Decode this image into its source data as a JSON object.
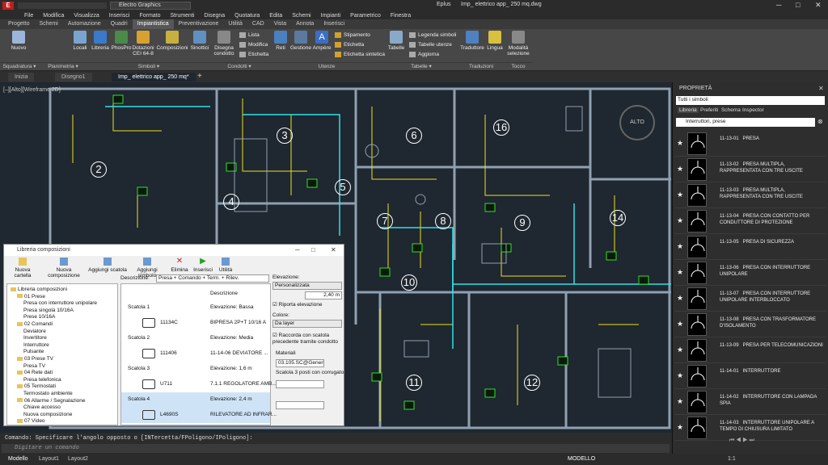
{
  "title_bar": {
    "app_name": "Electro Graphics",
    "product": "Eplus",
    "file": "Imp_ elettrico app_ 250 mq.dwg"
  },
  "menu": [
    "File",
    "Modifica",
    "Visualizza",
    "Inserisci",
    "Formato",
    "Strumenti",
    "Disegna",
    "Quotatura",
    "Edita",
    "Schemi",
    "Impianti",
    "Parametrico",
    "Finestra"
  ],
  "ribbon_tabs": [
    "Progetto",
    "Schemi",
    "Automazione",
    "Quadri",
    "Impiantistica",
    "Preventivazione",
    "Utilità",
    "CAD",
    "Vista",
    "Annota",
    "Inserisci"
  ],
  "ribbon_active": "Impiantistica",
  "ribbon": {
    "nuovo": "Nuovo",
    "locali": "Locali",
    "libreria": "Libreria",
    "phosphro": "PhosPro",
    "dotazioni": "Dotazioni CEI 64-8",
    "composizioni": "Composizioni",
    "sinottici": "Sinottici",
    "disegna": "Disegna condotto",
    "lista": "Lista",
    "modifica": "Modifica",
    "etichetta": "Etichetta",
    "reti": "Reti",
    "gestione": "Gestione",
    "ampere": "Ampère",
    "stipamento": "Stipamento",
    "etichetta2": "Etichetta",
    "etichetta_sintetica": "Etichetta sintetica",
    "tabelle": "Tabelle",
    "legenda": "Legenda simboli",
    "tabelle_utenze": "Tabelle utenze",
    "aggiorna": "Aggiorna",
    "traduttore": "Traduttore",
    "lingua": "Lingua",
    "modalita": "Modalità selezione",
    "groups": {
      "squadratura": "Squadratura ▾",
      "planimetria": "Planimetria ▾",
      "simboli": "Simboli ▾",
      "condotti": "Condotti ▾",
      "utenze": "Utenze",
      "tabelle": "Tabelle ▾",
      "traduzioni": "Traduzioni",
      "tocco": "Tocco"
    }
  },
  "doc_tabs": [
    "Inizia",
    "Disegno1",
    "Imp_ elettrico app_ 250 mq*"
  ],
  "viewport_label": "[–][Alto][Wireframe 2D]",
  "view_cube": "ALTO",
  "room_numbers": [
    "2",
    "3",
    "4",
    "5",
    "6",
    "7",
    "8",
    "9",
    "10",
    "11",
    "12",
    "14",
    "16"
  ],
  "dialog": {
    "title": "Libreria composizioni",
    "tools": [
      "Nuova cartella",
      "Nuova composizione",
      "Aggiungi scatola",
      "Aggiungi simbolo",
      "Elimina",
      "Inserisci",
      "Utilità"
    ],
    "tree": [
      {
        "label": "Libreria composizioni",
        "lvl": 0,
        "folder": true
      },
      {
        "label": "01 Prese",
        "lvl": 1,
        "folder": true
      },
      {
        "label": "Presa con interruttore unipolare",
        "lvl": 2,
        "folder": false
      },
      {
        "label": "Presa singola 10/16A",
        "lvl": 2,
        "folder": false
      },
      {
        "label": "Prese 10/16A",
        "lvl": 2,
        "folder": false
      },
      {
        "label": "02 Comandi",
        "lvl": 1,
        "folder": true
      },
      {
        "label": "Deviatore",
        "lvl": 2,
        "folder": false
      },
      {
        "label": "Invertitore",
        "lvl": 2,
        "folder": false
      },
      {
        "label": "Interruttore",
        "lvl": 2,
        "folder": false
      },
      {
        "label": "Pulsante",
        "lvl": 2,
        "folder": false
      },
      {
        "label": "03 Prese TV",
        "lvl": 1,
        "folder": true
      },
      {
        "label": "Presa TV",
        "lvl": 2,
        "folder": false
      },
      {
        "label": "04 Rete dati",
        "lvl": 1,
        "folder": true
      },
      {
        "label": "Presa telefonica",
        "lvl": 2,
        "folder": false
      },
      {
        "label": "05 Termostati",
        "lvl": 1,
        "folder": true
      },
      {
        "label": "Termostato ambiente",
        "lvl": 2,
        "folder": false
      },
      {
        "label": "06 Allarme / Segnalazione",
        "lvl": 1,
        "folder": true
      },
      {
        "label": "Chiave accesso",
        "lvl": 2,
        "folder": false
      },
      {
        "label": "Nuova composizione",
        "lvl": 2,
        "folder": false
      },
      {
        "label": "07 Video",
        "lvl": 1,
        "folder": true
      }
    ],
    "desc_label": "Descrizione:",
    "desc_value": "Presa + Comando + Term. + Rilev.",
    "col_header": "Descrizione",
    "rows": [
      {
        "scatola": "Scatola 1",
        "code": "",
        "desc": "Elevazione: Bassa"
      },
      {
        "scatola": "",
        "code": "11134C",
        "desc": "BIPRESA 2P+T 10/16 A"
      },
      {
        "scatola": "Scatola 2",
        "code": "",
        "desc": "Elevazione: Media"
      },
      {
        "scatola": "",
        "code": "111406",
        "desc": "11-14-06   DEVIATORE ..."
      },
      {
        "scatola": "Scatola 3",
        "code": "",
        "desc": "Elevazione: 1,6 m"
      },
      {
        "scatola": "",
        "code": "U711",
        "desc": "7.1.1 REGOLATORE AMB..."
      },
      {
        "scatola": "Scatola 4",
        "code": "",
        "desc": "Elevazione: 2,4 m"
      },
      {
        "scatola": "",
        "code": "L4690S",
        "desc": "RILEVATORE AD INFRAR..."
      }
    ],
    "elev_label": "Elevazione:",
    "elev_value": "Personalizzata",
    "elev_num": "2,40 m",
    "riporta": "Riporta elevazione",
    "colore_label": "Colore:",
    "colore_value": "Da layer",
    "raccorda": "Raccorda con scatola precedente tramite condotto",
    "materiali_label": "Materiali",
    "materiale_value": "03.105.SC@Generico",
    "materiale_desc": "Scatola 3 posti con corrugato"
  },
  "command": {
    "line1": "Comando: Specificare l'angolo opposto o [INTercetta/FPoligono/IPoligono]:",
    "prompt": "Digitare un comando"
  },
  "status": {
    "tabs": [
      "Modello",
      "Layout1",
      "Layout2"
    ],
    "mode": "MODELLO",
    "scale": "1:1"
  },
  "panel": {
    "title": "PROPRIETÀ",
    "filter": "Tutti i simboli",
    "tabs": [
      "Libreria",
      "Preferiti",
      "Schema",
      "Inspector"
    ],
    "category": "Interruttori, prese",
    "items": [
      {
        "code": "11-13-01",
        "name": "PRESA"
      },
      {
        "code": "11-13-02",
        "name": "PRESA MULTIPLA, RAPPRESENTATA CON TRE USCITE"
      },
      {
        "code": "11-13-03",
        "name": "PRESA MULTIPLA, RAPPRESENTATA CON TRE USCITE"
      },
      {
        "code": "11-13-04",
        "name": "PRESA CON CONTATTO PER CONDUTTORE DI PROTEZIONE"
      },
      {
        "code": "11-13-05",
        "name": "PRESA DI SICUREZZA"
      },
      {
        "code": "11-13-06",
        "name": "PRESA CON INTERRUTTORE UNIPOLARE"
      },
      {
        "code": "11-13-07",
        "name": "PRESA CON INTERRUTTORE UNIPOLARE INTERBLOCCATO"
      },
      {
        "code": "11-13-08",
        "name": "PRESA CON TRASFORMATORE D'ISOLAMENTO"
      },
      {
        "code": "11-13-09",
        "name": "PRESA PER TELECOMUNICAZIONI"
      },
      {
        "code": "11-14-01",
        "name": "INTERRUTTORE"
      },
      {
        "code": "11-14-02",
        "name": "INTERRUTTORE CON LAMPADA SPIA"
      },
      {
        "code": "11-14-03",
        "name": "INTERRUTTORE UNIPOLARE A TEMPO DI CHIUSURA LIMITATO"
      }
    ]
  },
  "colors": {
    "wall": "#8fa0b0",
    "wire_yellow": "#e8e020",
    "wire_cyan": "#30e0e8",
    "wire_green": "#30e030",
    "accent": "#2a6fc4"
  }
}
